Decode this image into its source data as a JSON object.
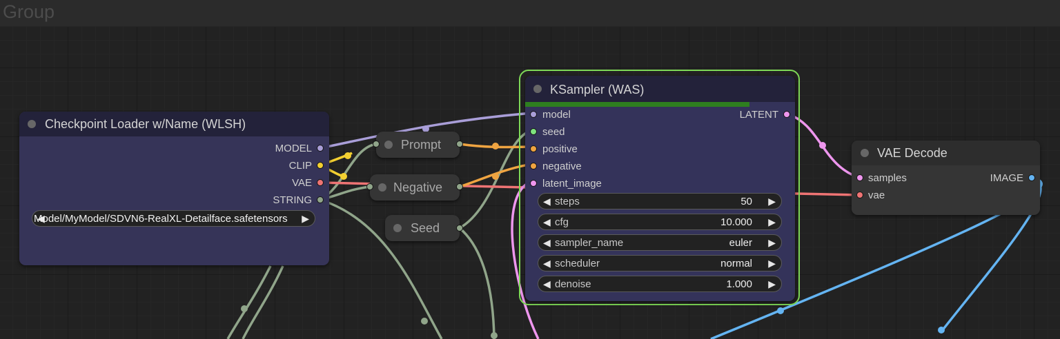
{
  "group": {
    "title": "Group"
  },
  "colors": {
    "model": "#a99ed8",
    "clip": "#f3d031",
    "vae": "#ef7474",
    "string": "#90a58a",
    "conditioning": "#efa441",
    "latent": "#ee96ee",
    "image": "#64b4f2",
    "seed_in": "#7ee27e",
    "selected_outline": "#7ed957",
    "progress": "#2e7f1f"
  },
  "checkpoint_loader": {
    "title": "Checkpoint Loader w/Name (WLSH)",
    "outputs": [
      "MODEL",
      "CLIP",
      "VAE",
      "STRING"
    ],
    "ckpt_name_value": "Model/MyModel/SDVN6-RealXL-Detailface.safetensors"
  },
  "reroutes": {
    "prompt": "Prompt",
    "negative": "Negative",
    "seed": "Seed"
  },
  "ksampler": {
    "title": "KSampler (WAS)",
    "progress": 0.83,
    "inputs": [
      "model",
      "seed",
      "positive",
      "negative",
      "latent_image"
    ],
    "output": "LATENT",
    "widgets": [
      {
        "label": "steps",
        "value": "50"
      },
      {
        "label": "cfg",
        "value": "10.000"
      },
      {
        "label": "sampler_name",
        "value": "euler"
      },
      {
        "label": "scheduler",
        "value": "normal"
      },
      {
        "label": "denoise",
        "value": "1.000"
      }
    ],
    "arrow_left": "◀",
    "arrow_right": "▶"
  },
  "vae_decode": {
    "title": "VAE Decode",
    "inputs": [
      "samples",
      "vae"
    ],
    "output": "IMAGE"
  }
}
